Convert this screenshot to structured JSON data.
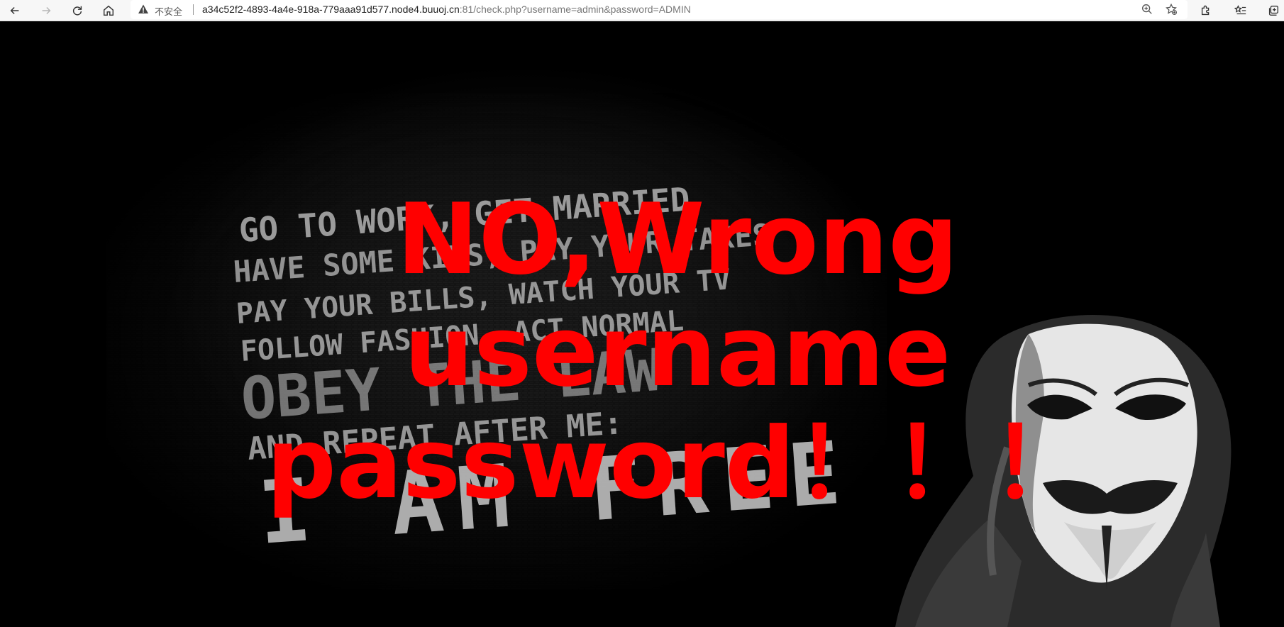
{
  "browser": {
    "security_label": "不安全",
    "url_host": "a34c52f2-4893-4a4e-918a-779aaa91d577.node4.buuoj.cn",
    "url_path": ":81/check.php?username=admin&password=ADMIN",
    "icons": [
      "back-icon",
      "forward-icon",
      "refresh-icon",
      "home-icon",
      "warning-icon",
      "zoom-icon",
      "favorite-add-icon",
      "extensions-icon",
      "favorites-icon",
      "collections-icon"
    ]
  },
  "page": {
    "poster_lines": [
      "GO TO WORK, GET MARRIED",
      "HAVE SOME KIDS, PAY YOUR TAXES",
      "PAY YOUR BILLS, WATCH YOUR TV",
      "FOLLOW FASHION, ACT NORMAL",
      "OBEY THE LAW",
      "AND REPEAT AFTER ME:",
      "I AM FREE"
    ],
    "error_message": "NO,Wrong username password！！！",
    "error_color": "#ff0000"
  }
}
